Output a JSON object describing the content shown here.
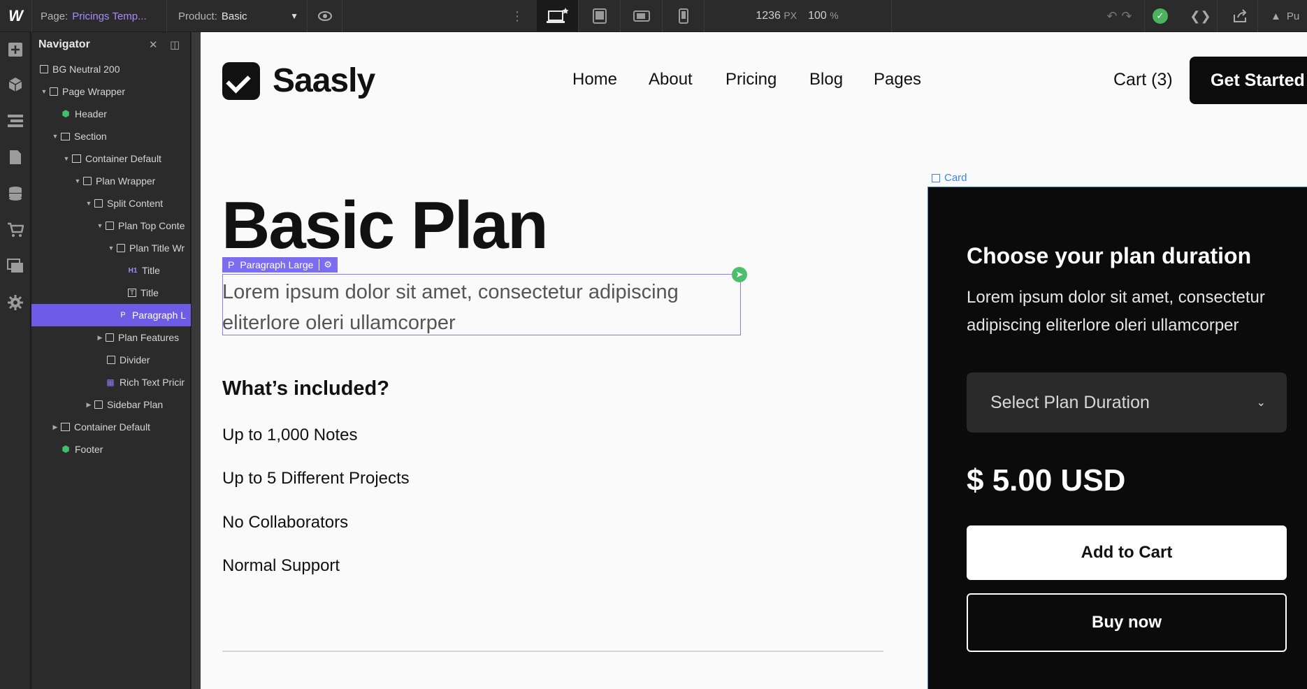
{
  "topbar": {
    "logo": "W",
    "page_key": "Page:",
    "page_value": "Pricings Temp...",
    "product_key": "Product:",
    "product_value": "Basic",
    "width_value": "1236",
    "width_unit": "PX",
    "zoom_value": "100",
    "zoom_unit": "%",
    "publish_label": "Pu"
  },
  "navigator": {
    "title": "Navigator",
    "items": [
      {
        "label": "BG Neutral 200"
      },
      {
        "label": "Page Wrapper"
      },
      {
        "label": "Header"
      },
      {
        "label": "Section"
      },
      {
        "label": "Container Default"
      },
      {
        "label": "Plan Wrapper"
      },
      {
        "label": "Split Content"
      },
      {
        "label": "Plan Top Conte"
      },
      {
        "label": "Plan Title Wr"
      },
      {
        "label": "Title",
        "badge": "H1"
      },
      {
        "label": "Title"
      },
      {
        "label": "Paragraph L",
        "badge": "P"
      },
      {
        "label": "Plan Features"
      },
      {
        "label": "Divider"
      },
      {
        "label": "Rich Text Pricir"
      },
      {
        "label": "Sidebar Plan"
      },
      {
        "label": "Container Default"
      },
      {
        "label": "Footer"
      }
    ]
  },
  "site": {
    "brand": "Saasly",
    "nav": [
      "Home",
      "About",
      "Pricing",
      "Blog",
      "Pages"
    ],
    "cart": "Cart (3)",
    "cta": "Get Started",
    "plan_title": "Basic Plan",
    "selected_tag": "Paragraph Large",
    "selected_tag_prefix": "P",
    "paragraph": "Lorem ipsum dolor sit amet, consectetur adipiscing eliterlore oleri ullamcorper",
    "included_heading": "What’s included?",
    "features": [
      "Up to 1,000 Notes",
      "Up to 5 Different Projects",
      "No Collaborators",
      "Normal Support"
    ]
  },
  "card": {
    "label": "Card",
    "heading": "Choose your plan duration",
    "text": "Lorem ipsum dolor sit amet, consectetur adipiscing eliterlore oleri ullamcorper",
    "select_placeholder": "Select Plan Duration",
    "price": "$ 5.00 USD",
    "add_to_cart": "Add to Cart",
    "buy_now": "Buy now"
  },
  "colors": {
    "accent_purple": "#7c6cf0",
    "selection_blue": "#3b82f6",
    "status_green": "#4bb35c"
  }
}
